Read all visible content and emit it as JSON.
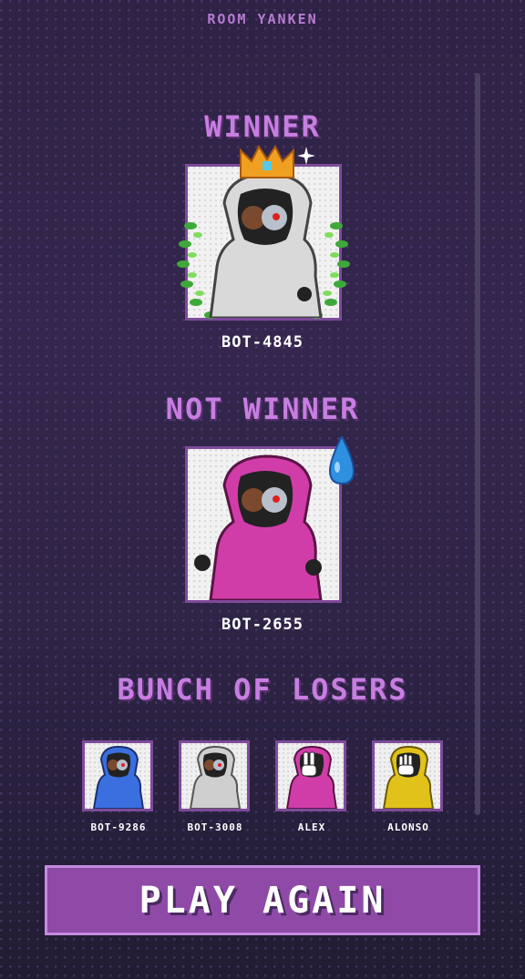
{
  "room": {
    "title": "ROOM YANKEN"
  },
  "sections": {
    "winner_heading": "WINNER",
    "not_winner_heading": "NOT WINNER",
    "losers_heading": "BUNCH OF LOSERS"
  },
  "winner": {
    "name": "BOT-4845",
    "hood_color": "#d9d9d9",
    "icon": "crown-icon"
  },
  "not_winner": {
    "name": "BOT-2655",
    "hood_color": "#d13da8",
    "icon": "sweat-drop-icon"
  },
  "losers": [
    {
      "name": "BOT-9286",
      "hood_color": "#3b6fe0",
      "hand": "none"
    },
    {
      "name": "BOT-3008",
      "hood_color": "#cfcfcf",
      "hand": "none"
    },
    {
      "name": "ALEX",
      "hood_color": "#d13da8",
      "hand": "scissors"
    },
    {
      "name": "ALONSO",
      "hood_color": "#e0c21a",
      "hand": "paper"
    }
  ],
  "actions": {
    "play_again_label": "PLAY AGAIN"
  },
  "colors": {
    "accent": "#c67fe0",
    "button": "#8e4aa6",
    "border": "#7e4a9c"
  }
}
